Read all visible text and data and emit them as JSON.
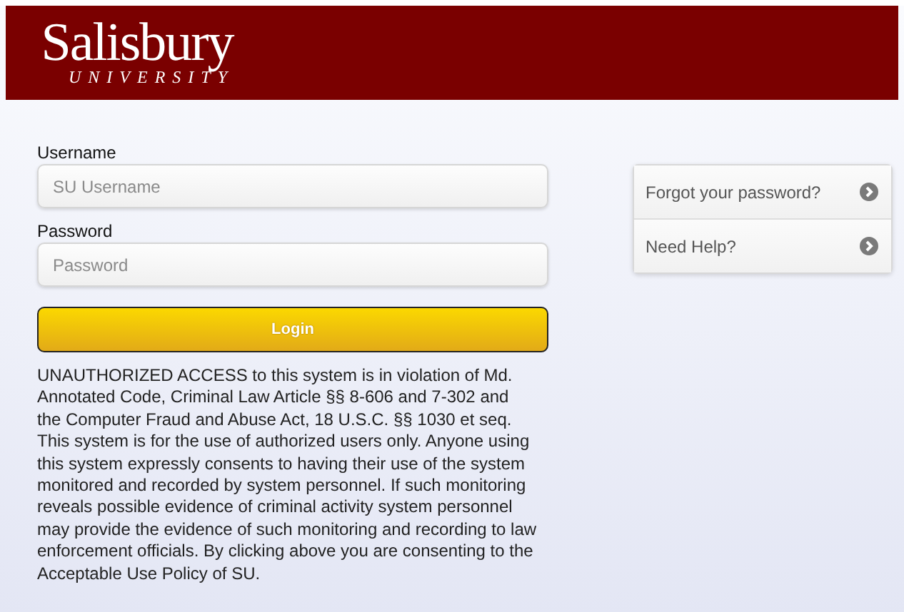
{
  "header": {
    "logo_name": "Salisbury",
    "logo_sub": "UNIVERSITY"
  },
  "login_form": {
    "fields": [
      {
        "label": "Username",
        "placeholder": "SU Username"
      },
      {
        "label": "Password",
        "placeholder": "Password"
      }
    ],
    "button": "Login",
    "notice": "UNAUTHORIZED ACCESS to this system is in violation of Md. Annotated Code, Criminal Law Article §§ 8-606 and 7-302 and the Computer Fraud and Abuse Act, 18 U.S.C. §§ 1030 et seq. This system is for the use of authorized users only. Anyone using this system expressly consents to having their use of the system monitored and recorded by system personnel. If such monitoring reveals possible evidence of criminal activity system personnel may provide the evidence of such monitoring and recording to law enforcement officials. By clicking above you are consenting to the Acceptable Use Policy of SU."
  },
  "help_links": [
    "Forgot your password?",
    "Need Help?"
  ]
}
